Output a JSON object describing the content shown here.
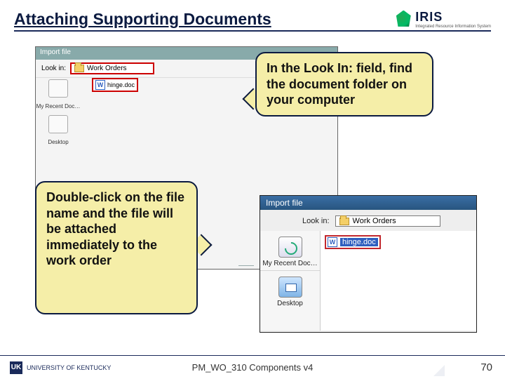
{
  "header": {
    "title": "Attaching Supporting Documents",
    "logo_text": "IRIS",
    "logo_subtitle": "Integrated Resource\nInformation System"
  },
  "callouts": {
    "right": "In the Look In: field, find the document folder on your computer",
    "left": "Double-click on the file name and the file will be attached immediately to the work order"
  },
  "dialog_back": {
    "title": "Import file",
    "look_label": "Look in:",
    "look_value": "Work Orders",
    "file_name": "hinge.doc",
    "sidebar": [
      "My Recent Doc…",
      "Desktop"
    ]
  },
  "dialog_front": {
    "title": "Import file",
    "look_label": "Look in:",
    "look_value": "Work Orders",
    "file_name": "hinge.doc",
    "sidebar": [
      "My Recent Doc…",
      "Desktop"
    ]
  },
  "footer": {
    "org": "UNIVERSITY OF KENTUCKY",
    "org_mark": "UK",
    "center": "PM_WO_310 Components v4",
    "page": "70"
  }
}
